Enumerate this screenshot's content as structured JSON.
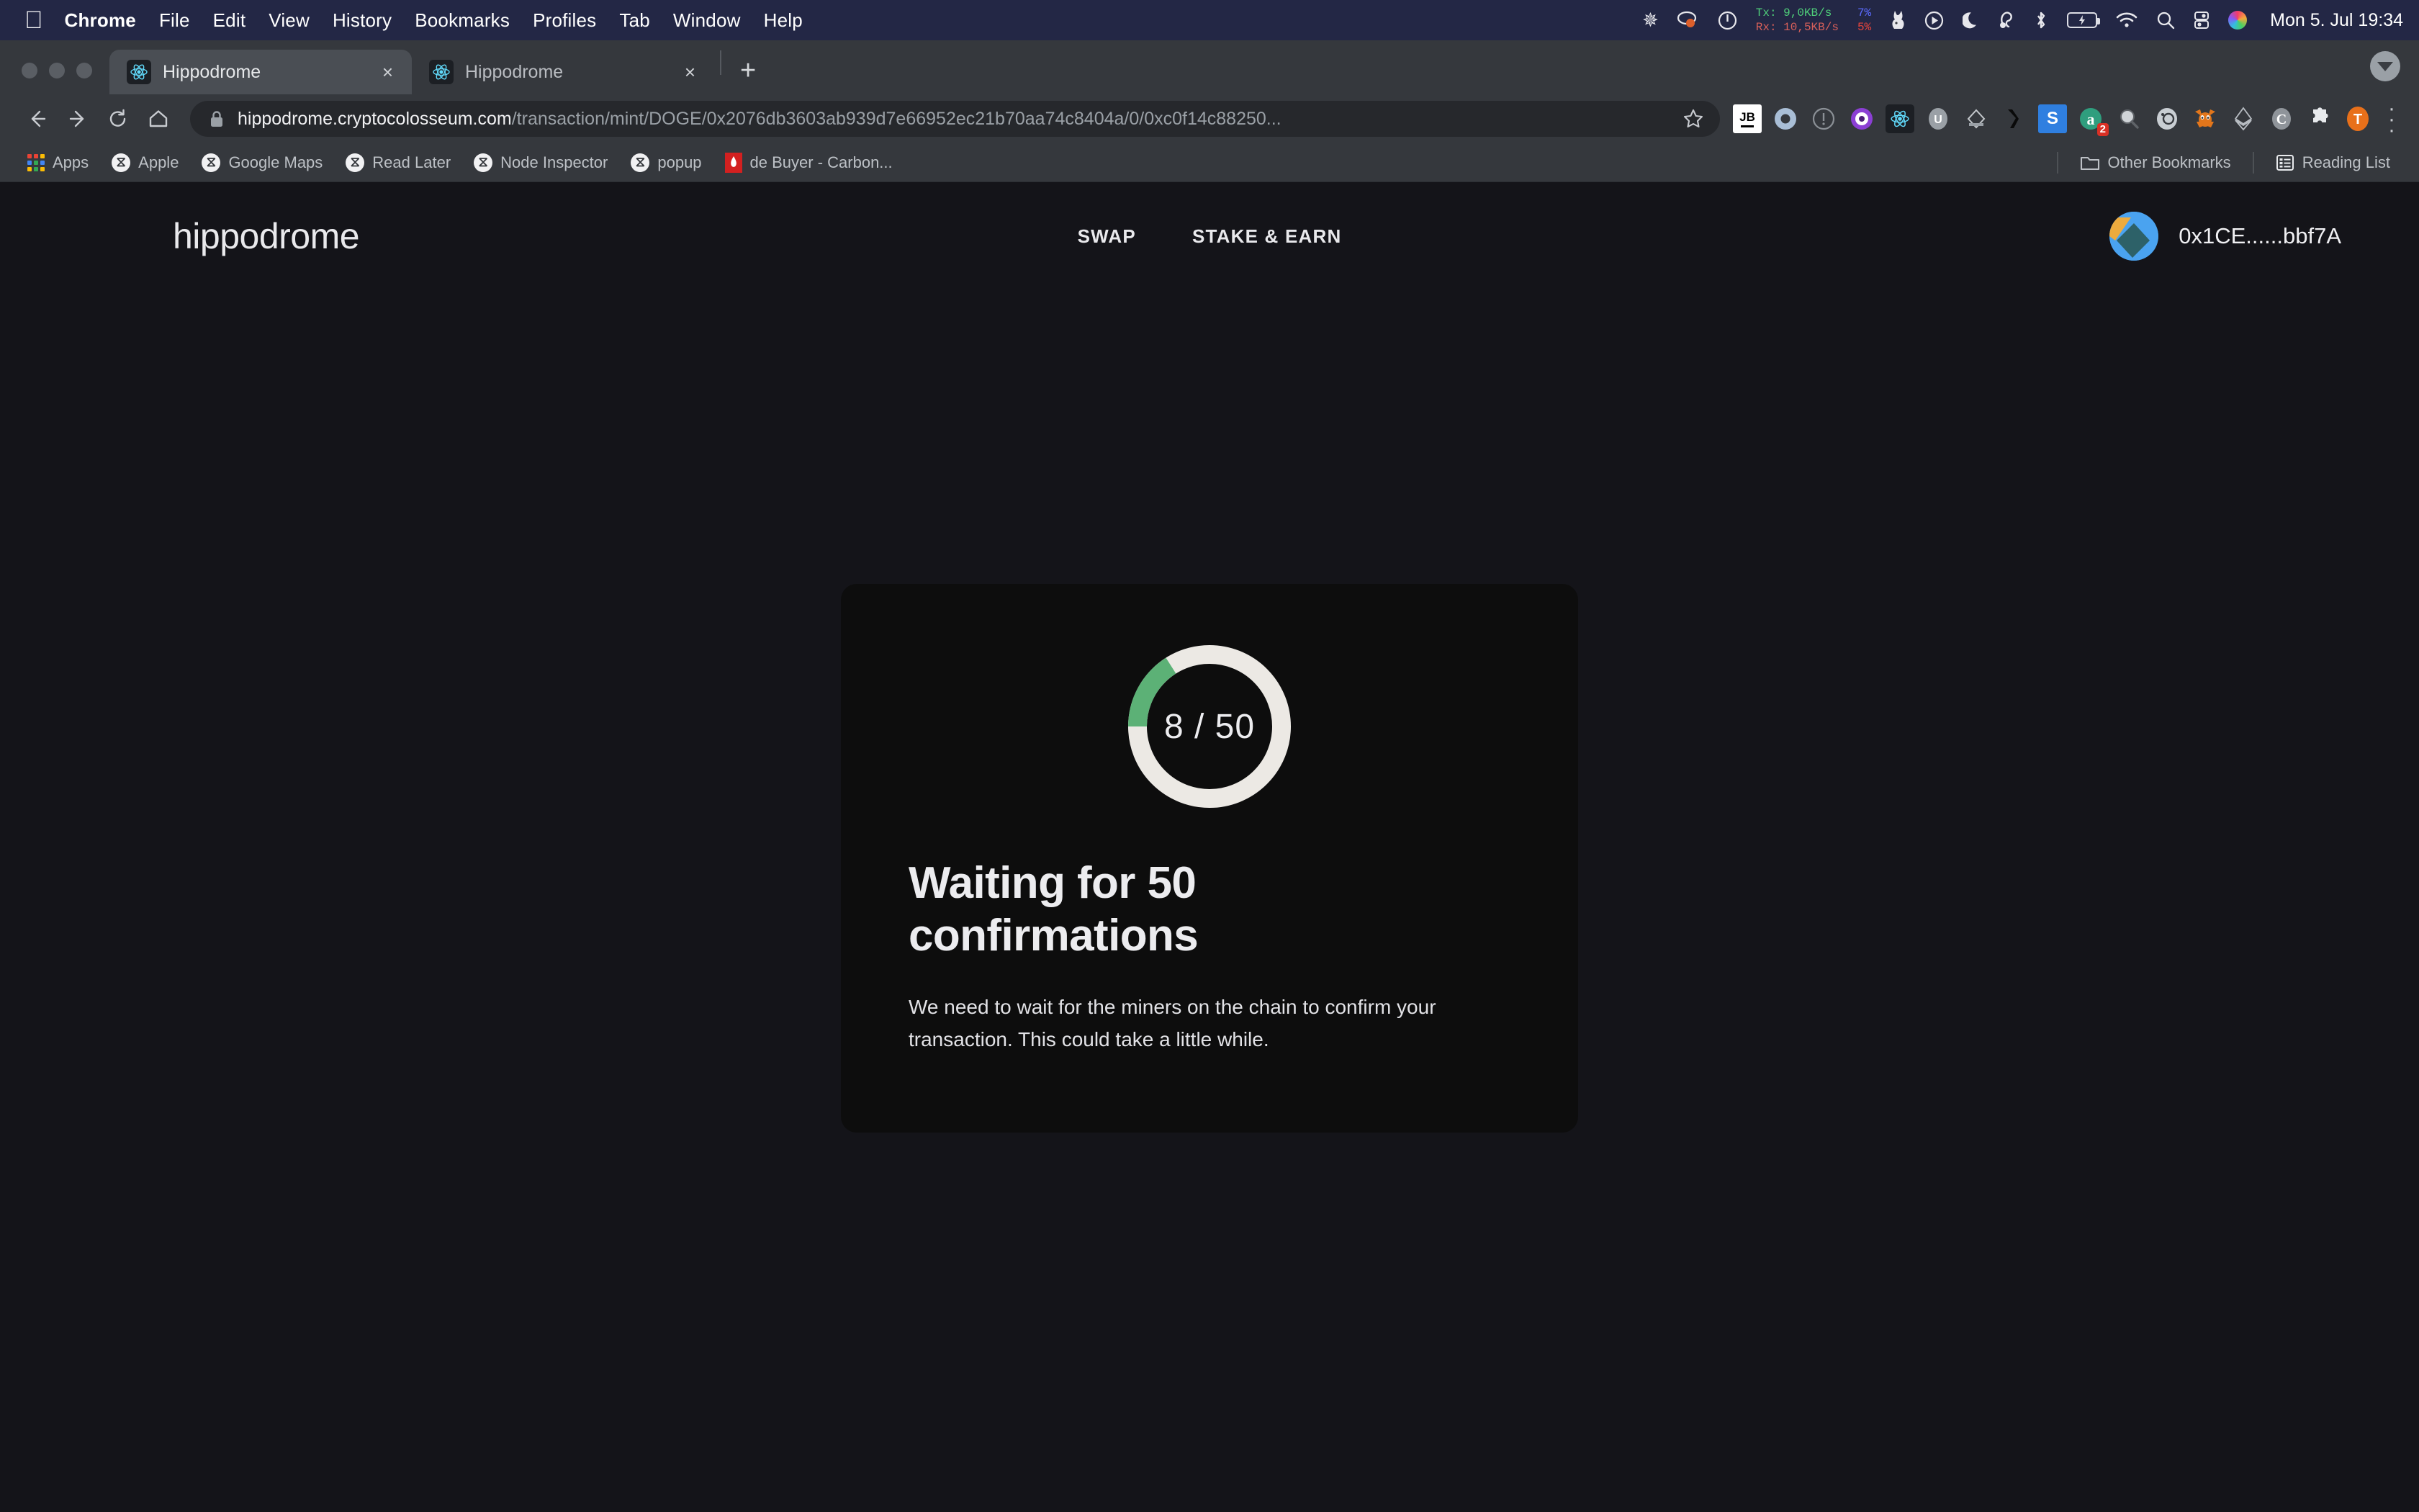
{
  "menubar": {
    "apple_icon": "apple-logo",
    "items": [
      "Chrome",
      "File",
      "Edit",
      "View",
      "History",
      "Bookmarks",
      "Profiles",
      "Tab",
      "Window",
      "Help"
    ],
    "status": {
      "icons": [
        "asterisk-icon",
        "eye-record-icon",
        "power-circle-icon"
      ],
      "network_tx": "Tx:  9,0KB/s",
      "network_rx": "Rx: 10,5KB/s",
      "cpu_pct_blue": "7%",
      "cpu_pct_red": "5%",
      "right_icons": [
        "bunny-icon",
        "play-circle-icon",
        "moon-icon",
        "headphone-icon",
        "bluetooth-icon",
        "battery-charging-icon",
        "wifi-icon",
        "search-icon",
        "control-center-icon",
        "siri-icon"
      ],
      "clock": "Mon 5. Jul  19:34"
    }
  },
  "chrome": {
    "tabs": [
      {
        "title": "Hippodrome",
        "active": true,
        "close_label": "×"
      },
      {
        "title": "Hippodrome",
        "active": false,
        "close_label": "×"
      }
    ],
    "new_tab_label": "+",
    "toolbar": {
      "back_icon": "back-arrow-icon",
      "forward_icon": "forward-arrow-icon",
      "reload_icon": "reload-icon",
      "home_icon": "home-icon",
      "lock_icon": "lock-icon",
      "url_host": "hippodrome.cryptocolosseum.com",
      "url_path": "/transaction/mint/DOGE/0x2076db3603ab939d7e66952ec21b70aa74c8404a/0/0xc0f14c88250...",
      "star_icon": "bookmark-star-icon",
      "menu_icon": "chrome-menu-icon",
      "extensions": [
        {
          "name": "jetbrains-extension",
          "label": "JB",
          "bg": "#ffffff",
          "fg": "#000000",
          "badge": null
        },
        {
          "name": "blue-ring-extension",
          "label": "",
          "bg": "#9fb8d4",
          "fg": "#ffffff",
          "badge": null
        },
        {
          "name": "info-extension",
          "label": "!",
          "bg": "#6e7276",
          "fg": "#d8d8d8",
          "badge": null
        },
        {
          "name": "purple-dot-extension",
          "label": "",
          "bg": "#8b3fd4",
          "fg": "#ffffff",
          "badge": null
        },
        {
          "name": "react-extension",
          "label": "",
          "bg": "#1c1f24",
          "fg": "#61dafb",
          "badge": null
        },
        {
          "name": "u-extension",
          "label": "U",
          "bg": "#9aa0a6",
          "fg": "#ffffff",
          "badge": null
        },
        {
          "name": "diamond-extension",
          "label": "",
          "bg": "#c4c8cc",
          "fg": "#6b6f74",
          "badge": null
        },
        {
          "name": "x-black-extension",
          "label": "",
          "bg": "#35383d",
          "fg": "#000000",
          "badge": null
        },
        {
          "name": "s-blue-extension",
          "label": "S",
          "bg": "#2f7fe0",
          "fg": "#ffffff",
          "badge": null
        },
        {
          "name": "a-green-extension",
          "label": "a",
          "bg": "#2f9e7e",
          "fg": "#ffffff",
          "badge": "2"
        },
        {
          "name": "magnifier-extension",
          "label": "",
          "bg": "#7d828a",
          "fg": "#ffffff",
          "badge": null
        },
        {
          "name": "camera-extension",
          "label": "",
          "bg": "#b9bec4",
          "fg": "#35383d",
          "badge": null
        },
        {
          "name": "metamask-extension",
          "label": "",
          "bg": "#e2761b",
          "fg": "#ffffff",
          "badge": null
        },
        {
          "name": "ethereum-extension",
          "label": "",
          "bg": "#9aa0a6",
          "fg": "#ffffff",
          "badge": null
        },
        {
          "name": "c-extension",
          "label": "C",
          "bg": "#8f949a",
          "fg": "#ffffff",
          "badge": null
        },
        {
          "name": "puzzle-extension",
          "label": "",
          "bg": "#35383d",
          "fg": "#e8eaed",
          "badge": null
        },
        {
          "name": "profile-avatar",
          "label": "T",
          "bg": "#e8701a",
          "fg": "#ffffff",
          "badge": null
        }
      ]
    },
    "bookmarks": {
      "items": [
        {
          "label": "Apps",
          "icon": "apps-grid-icon"
        },
        {
          "label": "Apple",
          "icon": "globe-icon"
        },
        {
          "label": "Google Maps",
          "icon": "globe-icon"
        },
        {
          "label": "Read Later",
          "icon": "globe-icon"
        },
        {
          "label": "Node Inspector",
          "icon": "globe-icon"
        },
        {
          "label": "popup",
          "icon": "globe-icon"
        },
        {
          "label": "de Buyer - Carbon...",
          "icon": "red-favicon"
        }
      ],
      "other_bookmarks": "Other Bookmarks",
      "reading_list": "Reading List"
    }
  },
  "site": {
    "logo": "hippodrome",
    "nav": [
      {
        "label": "SWAP"
      },
      {
        "label": "STAKE & EARN"
      }
    ],
    "wallet_address": "0x1CE......bbf7A",
    "card": {
      "progress_label": "8 / 50",
      "title": "Waiting for 50 confirmations",
      "body": "We need to wait for the miners on the chain to confirm your transaction. This could take a little while.",
      "progress": {
        "current": 8,
        "total": 50,
        "percent": 16
      },
      "colors": {
        "arc": "#5cb176",
        "track": "#ece9e4",
        "card_bg": "#0d0d0d",
        "page_bg": "#141419"
      }
    }
  }
}
